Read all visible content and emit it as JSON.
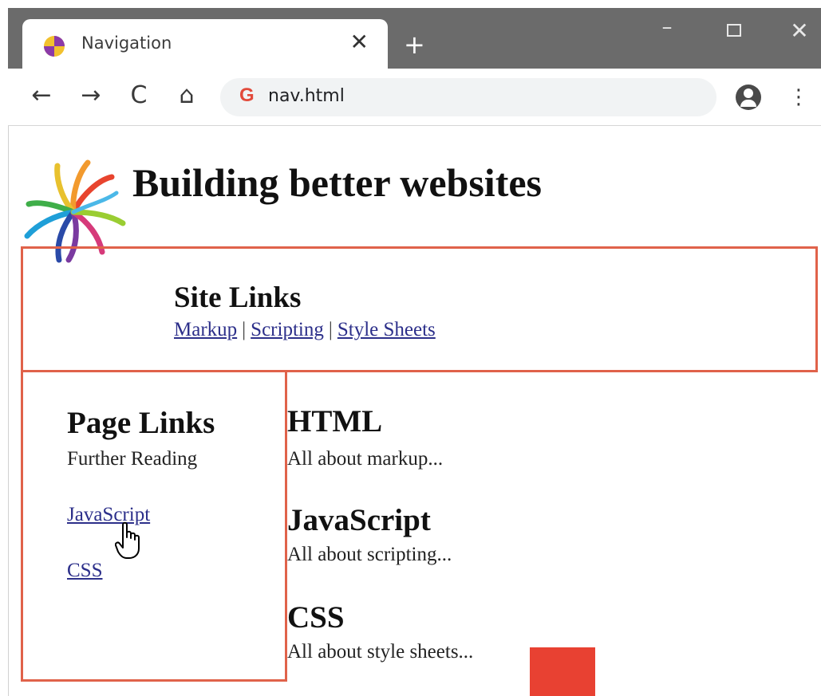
{
  "browser": {
    "tab_title": "Navigation",
    "tab_close": "✕",
    "new_tab": "+",
    "window": {
      "minimize": "–",
      "close": "✕"
    },
    "nav": {
      "back": "←",
      "forward": "→",
      "reload": "C",
      "home": "⌂"
    },
    "omnibox": {
      "engine_glyph": "G",
      "url": "nav.html"
    },
    "menu": "⋮"
  },
  "page": {
    "title": "Building better websites",
    "site_links": {
      "heading": "Site Links",
      "links": [
        "Markup",
        "Scripting",
        "Style Sheets"
      ],
      "separator": "|"
    },
    "page_links": {
      "heading": "Page Links",
      "subtitle": "Further Reading",
      "links": [
        "JavaScript",
        "CSS"
      ]
    },
    "sections": [
      {
        "heading": "HTML",
        "text": "All about markup..."
      },
      {
        "heading": "JavaScript",
        "text": "All about scripting..."
      },
      {
        "heading": "CSS",
        "text": "All about style sheets..."
      }
    ]
  },
  "colors": {
    "box_border": "#e0624a",
    "link": "#2c2f8a",
    "red_square": "#e84132",
    "titlebar": "#6b6b6b"
  }
}
